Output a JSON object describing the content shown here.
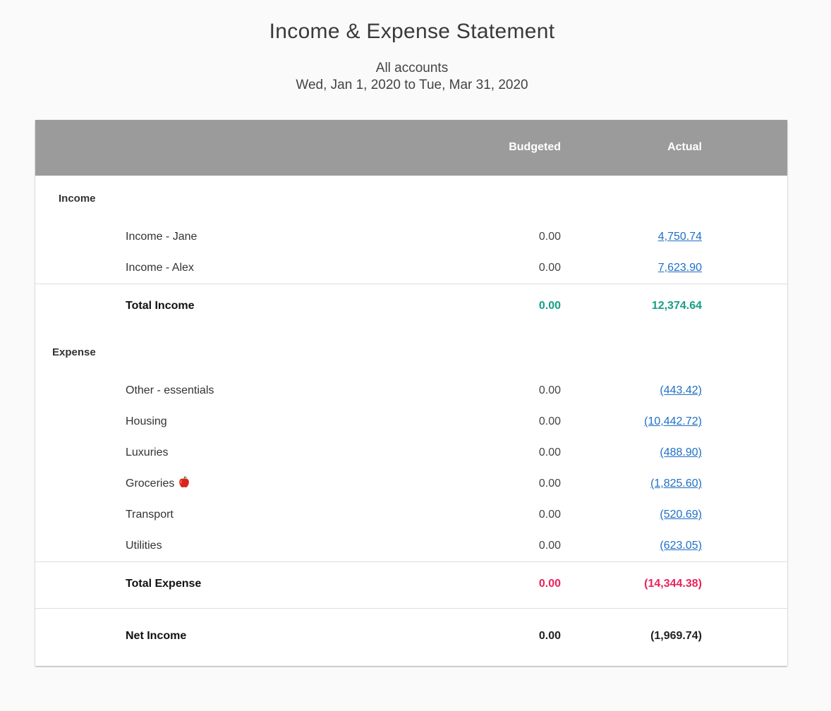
{
  "report": {
    "title": "Income & Expense Statement",
    "accounts": "All accounts",
    "date_range": "Wed, Jan 1, 2020 to Tue, Mar 31, 2020"
  },
  "columns": {
    "budgeted": "Budgeted",
    "actual": "Actual"
  },
  "income": {
    "label": "Income",
    "rows": [
      {
        "name": "Income - Jane",
        "budgeted": "0.00",
        "actual": "4,750.74"
      },
      {
        "name": "Income - Alex",
        "budgeted": "0.00",
        "actual": "7,623.90"
      }
    ],
    "total": {
      "name": "Total Income",
      "budgeted": "0.00",
      "actual": "12,374.64"
    }
  },
  "expense": {
    "label": "Expense",
    "rows": [
      {
        "name": "Other - essentials",
        "budgeted": "0.00",
        "actual": "(443.42)"
      },
      {
        "name": "Housing",
        "budgeted": "0.00",
        "actual": "(10,442.72)"
      },
      {
        "name": "Luxuries",
        "budgeted": "0.00",
        "actual": "(488.90)"
      },
      {
        "name": "Groceries",
        "icon": "apple-icon",
        "budgeted": "0.00",
        "actual": "(1,825.60)"
      },
      {
        "name": "Transport",
        "budgeted": "0.00",
        "actual": "(520.69)"
      },
      {
        "name": "Utilities",
        "budgeted": "0.00",
        "actual": "(623.05)"
      }
    ],
    "total": {
      "name": "Total Expense",
      "budgeted": "0.00",
      "actual": "(14,344.38)"
    }
  },
  "net": {
    "name": "Net Income",
    "budgeted": "0.00",
    "actual": "(1,969.74)"
  },
  "colors": {
    "header_bg": "#9b9b9b",
    "link": "#1f6fc5",
    "income_total": "#16a085",
    "expense_total": "#e8245c",
    "net_total": "#222222"
  }
}
